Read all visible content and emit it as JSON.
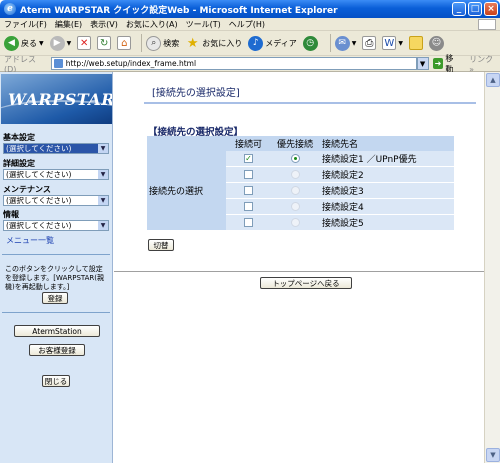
{
  "window": {
    "title": "Aterm WARPSTAR クイック設定Web - Microsoft Internet Explorer",
    "controls": [
      "_",
      "□",
      "×"
    ]
  },
  "menu": [
    "ファイル(F)",
    "編集(E)",
    "表示(V)",
    "お気に入り(A)",
    "ツール(T)",
    "ヘルプ(H)"
  ],
  "toolbar": {
    "back": "戻る",
    "search": "検索",
    "favorites": "お気に入り",
    "media": "メディア"
  },
  "address": {
    "label": "アドレス(D)",
    "url": "http://web.setup/index_frame.html",
    "go": "移動",
    "links": "リンク »"
  },
  "sidebar": {
    "logo": "WARPSTAR",
    "sections": [
      {
        "header": "基本設定",
        "value": "(選択してください)",
        "active": true
      },
      {
        "header": "詳細設定",
        "value": "(選択してください)",
        "active": false
      },
      {
        "header": "メンテナンス",
        "value": "(選択してください)",
        "active": false
      },
      {
        "header": "情報",
        "value": "(選択してください)",
        "active": false
      }
    ],
    "menu_list": "メニュー一覧",
    "note": "このボタンをクリックして設定を登録します。[WARPSTAR(親機)を再起動します。]",
    "register": "登録",
    "aterm_station": "AtermStation",
    "customer_register": "お客様登録",
    "close": "閉じる"
  },
  "main": {
    "page_title": "[接続先の選択設定]",
    "section_title": "【接続先の選択設定】",
    "headers": [
      "接続可",
      "優先接続",
      "接続先名"
    ],
    "row_label": "接続先の選択",
    "rows": [
      {
        "name": "接続設定1 ／UPnP優先",
        "checked": true,
        "priority": true
      },
      {
        "name": "接続設定2",
        "checked": false,
        "priority": false
      },
      {
        "name": "接続設定3",
        "checked": false,
        "priority": false
      },
      {
        "name": "接続設定4",
        "checked": false,
        "priority": false
      },
      {
        "name": "接続設定5",
        "checked": false,
        "priority": false
      }
    ],
    "switch_button": "切替",
    "top_button": "トップページへ戻る"
  }
}
